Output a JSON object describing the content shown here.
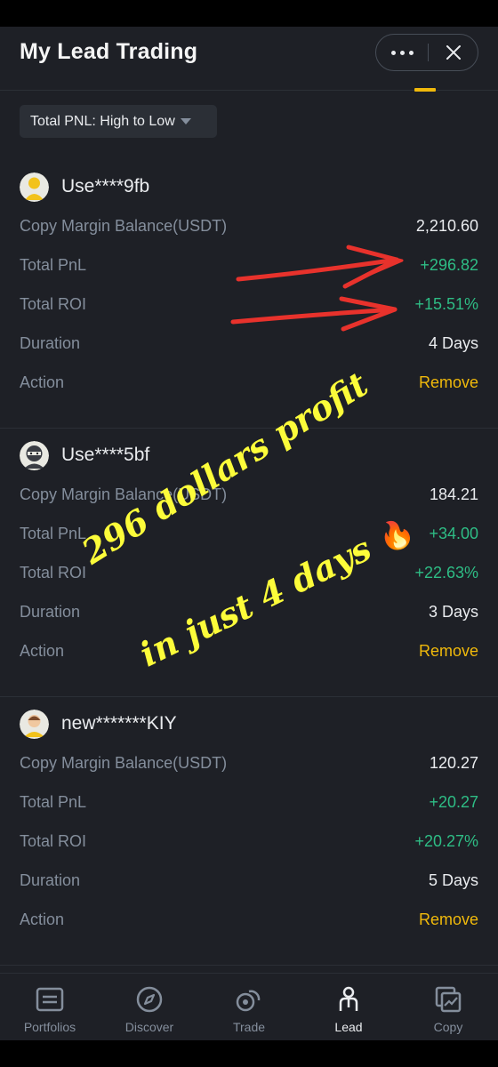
{
  "header": {
    "title": "My Lead Trading"
  },
  "sort": {
    "label": "Total PNL: High to Low"
  },
  "traders": [
    {
      "username": "Use****9fb",
      "avatar": "yellow-person-icon",
      "rows": {
        "margin_label": "Copy Margin Balance(USDT)",
        "margin_value": "2,210.60",
        "pnl_label": "Total PnL",
        "pnl_value": "+296.82",
        "roi_label": "Total ROI",
        "roi_value": "+15.51%",
        "duration_label": "Duration",
        "duration_value": "4 Days",
        "action_label": "Action",
        "action_value": "Remove"
      }
    },
    {
      "username": "Use****5bf",
      "avatar": "ninja-icon",
      "rows": {
        "margin_label": "Copy Margin Balance(USDT)",
        "margin_value": "184.21",
        "pnl_label": "Total PnL",
        "pnl_value": "+34.00",
        "roi_label": "Total ROI",
        "roi_value": "+22.63%",
        "duration_label": "Duration",
        "duration_value": "3 Days",
        "action_label": "Action",
        "action_value": "Remove"
      }
    },
    {
      "username": "new*******KIY",
      "avatar": "brown-hair-person-icon",
      "rows": {
        "margin_label": "Copy Margin Balance(USDT)",
        "margin_value": "120.27",
        "pnl_label": "Total PnL",
        "pnl_value": "+20.27",
        "roi_label": "Total ROI",
        "roi_value": "+20.27%",
        "duration_label": "Duration",
        "duration_value": "5 Days",
        "action_label": "Action",
        "action_value": "Remove"
      }
    }
  ],
  "overlay": {
    "line1": "296 dollars profit",
    "line2": "in just 4 days",
    "emoji": "🔥"
  },
  "nav": [
    {
      "label": "Portfolios",
      "icon": "portfolio-icon"
    },
    {
      "label": "Discover",
      "icon": "compass-icon"
    },
    {
      "label": "Trade",
      "icon": "trade-icon"
    },
    {
      "label": "Lead",
      "icon": "lead-person-icon"
    },
    {
      "label": "Copy",
      "icon": "copy-chart-icon"
    }
  ],
  "colors": {
    "background": "#1e2026",
    "accent": "#f0b90b",
    "positive": "#2ebd85",
    "muted": "#848e9c",
    "annotation_text": "#fcfc3a",
    "annotation_arrow": "#e8322c"
  }
}
